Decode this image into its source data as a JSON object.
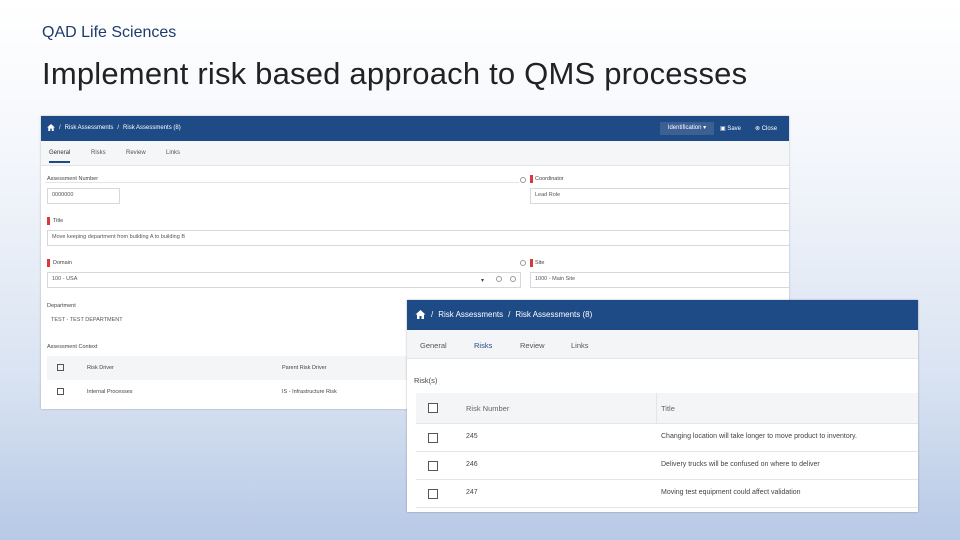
{
  "slide": {
    "brand": "QAD Life Sciences",
    "title": "Implement risk based approach to QMS processes"
  },
  "back_window": {
    "breadcrumb": [
      "/",
      "Risk Assessments",
      "/",
      "Risk Assessments (8)"
    ],
    "identification_label": "Identification",
    "save_label": "Save",
    "close_label": "Close",
    "tabs": [
      "General",
      "Risks",
      "Review",
      "Links"
    ],
    "active_tab": "General",
    "fields": {
      "assessment_number_label": "Assessment Number",
      "assessment_number_value": "0000000",
      "coordinator_label": "Coordinator",
      "coordinator_value": "Lead Role",
      "title_label": "Title",
      "title_value": "Move keeping department from building A to building B",
      "domain_label": "Domain",
      "domain_value": "100 - USA",
      "site_label": "Site",
      "site_value": "1000 - Main Site",
      "department_label": "Department",
      "department_value": "TEST - TEST DEPARTMENT",
      "assessment_context_label": "Assessment Context"
    },
    "context_table": {
      "columns": [
        "Risk Driver",
        "Parent Risk Driver"
      ],
      "rows": [
        [
          "Internal Processes",
          "IS - Infrastructure Risk"
        ]
      ]
    }
  },
  "front_window": {
    "breadcrumb": [
      "/",
      "Risk Assessments",
      "/",
      "Risk Assessments (8)"
    ],
    "tabs": [
      "General",
      "Risks",
      "Review",
      "Links"
    ],
    "active_tab": "Risks",
    "section_label": "Risk(s)",
    "columns": [
      "Risk Number",
      "Title"
    ],
    "rows": [
      {
        "number": "245",
        "title": "Changing location will take longer to move product to inventory."
      },
      {
        "number": "246",
        "title": "Delivery trucks will be confused on where to deliver"
      },
      {
        "number": "247",
        "title": "Moving test equipment could affect validation"
      }
    ]
  },
  "colors": {
    "header_blue": "#1e4a86",
    "brand_text": "#1f3a6b",
    "required_marker": "#d73a3a"
  }
}
